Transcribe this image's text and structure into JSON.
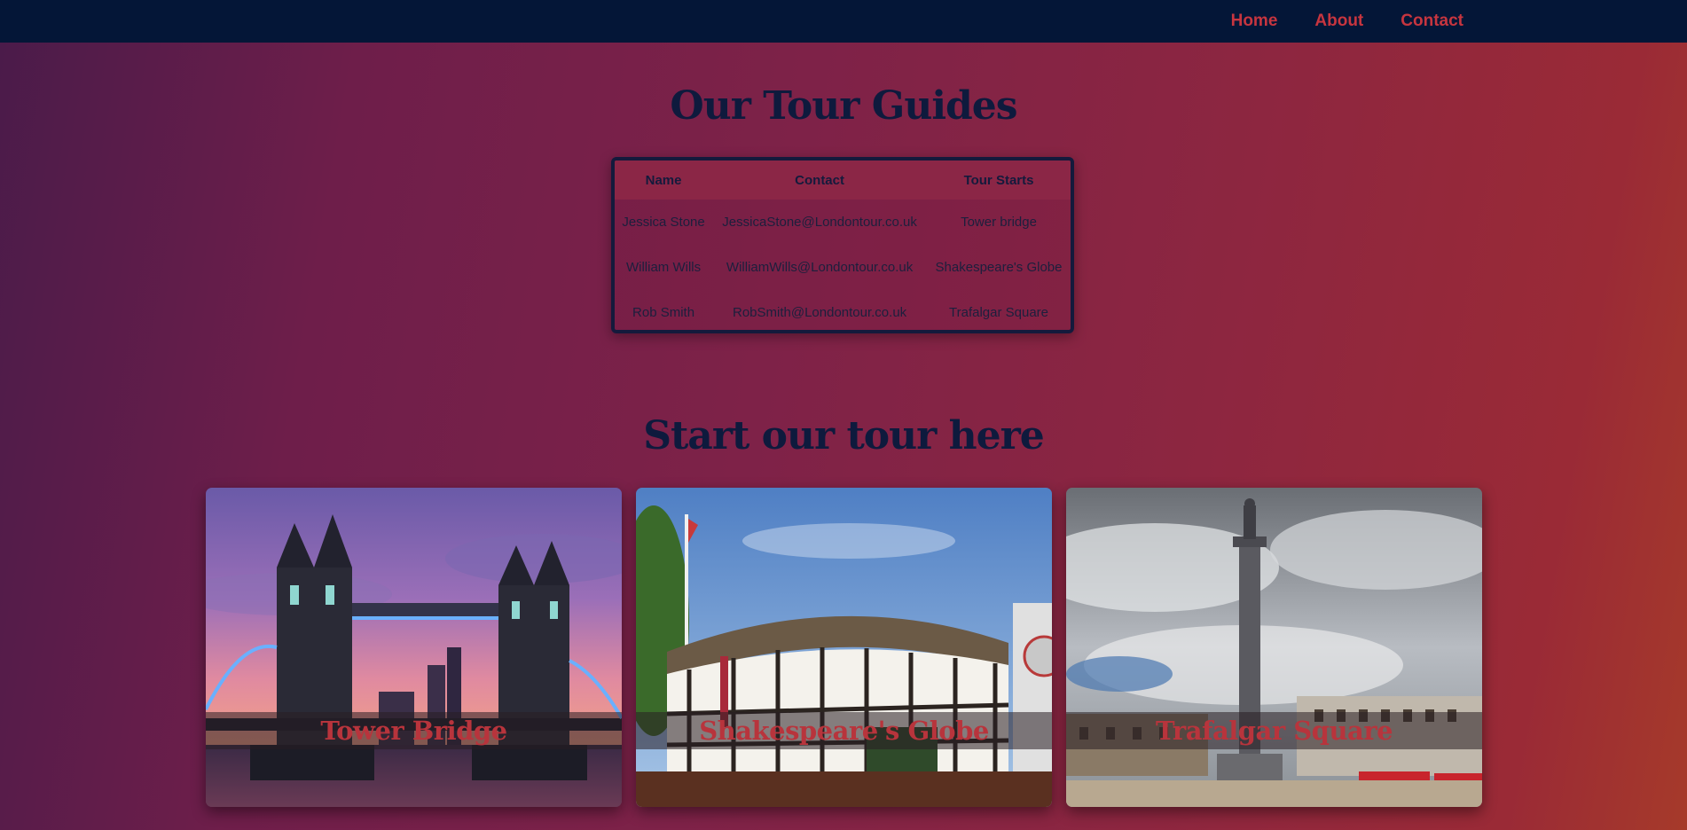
{
  "nav": {
    "items": [
      {
        "label": "Home"
      },
      {
        "label": "About"
      },
      {
        "label": "Contact"
      }
    ]
  },
  "guides": {
    "title": "Our Tour Guides",
    "headers": [
      "Name",
      "Contact",
      "Tour Starts"
    ],
    "rows": [
      [
        "Jessica Stone",
        "JessicaStone@Londontour.co.uk",
        "Tower bridge"
      ],
      [
        "William Wills",
        "WilliamWills@Londontour.co.uk",
        "Shakespeare's Globe"
      ],
      [
        "Rob Smith",
        "RobSmith@Londontour.co.uk",
        "Trafalgar Square"
      ]
    ]
  },
  "tour": {
    "title": "Start our tour here",
    "cards": [
      {
        "caption": "Tower Bridge",
        "image": "tower-bridge-photo"
      },
      {
        "caption": "Shakespeare's Globe",
        "image": "shakespeares-globe-photo"
      },
      {
        "caption": "Trafalgar Square",
        "image": "trafalgar-square-photo"
      }
    ]
  },
  "colors": {
    "navbar": "#041637",
    "nav_link": "#c7353f",
    "heading": "#0e1a3d",
    "caption": "#b8343c"
  }
}
